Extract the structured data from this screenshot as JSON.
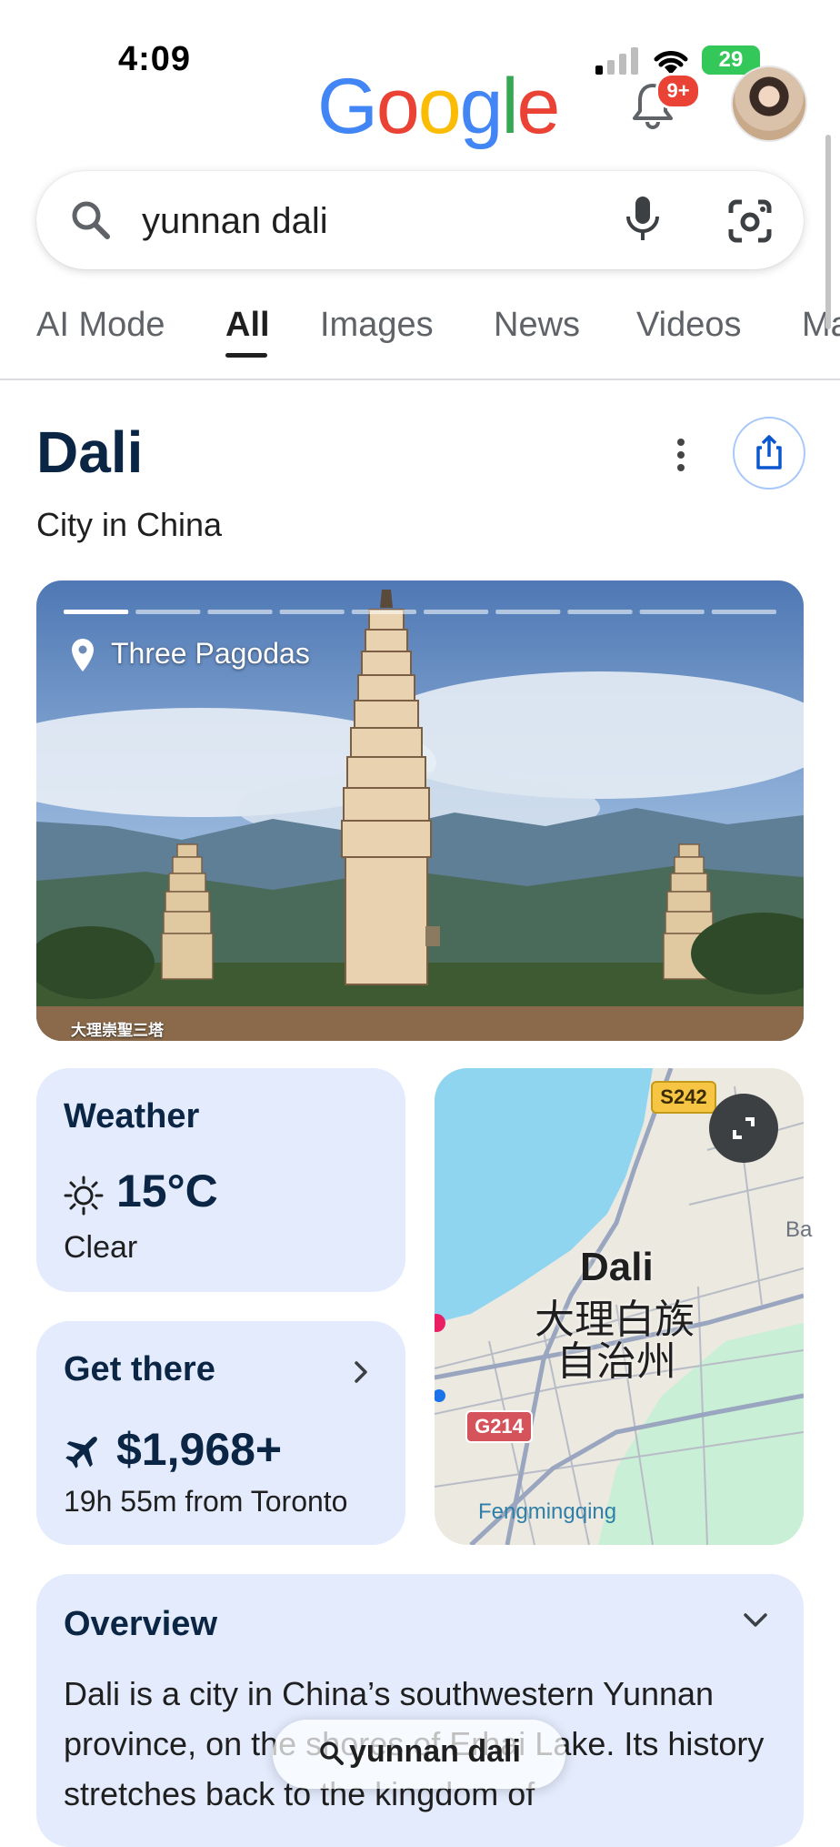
{
  "status_bar": {
    "time": "4:09",
    "battery": "29"
  },
  "header": {
    "logo_letters": [
      "G",
      "o",
      "o",
      "g",
      "l",
      "e"
    ],
    "logo_colors": [
      "#4285F4",
      "#EA4335",
      "#FBBC05",
      "#4285F4",
      "#34A853",
      "#EA4335"
    ],
    "notifications_badge": "9+"
  },
  "search": {
    "query": "yunnan dali"
  },
  "tabs": [
    {
      "label": "AI Mode",
      "active": false
    },
    {
      "label": "All",
      "active": true
    },
    {
      "label": "Images",
      "active": false
    },
    {
      "label": "News",
      "active": false
    },
    {
      "label": "Videos",
      "active": false
    },
    {
      "label": "Ma",
      "active": false
    }
  ],
  "entity": {
    "title": "Dali",
    "subtitle": "City in China"
  },
  "hero": {
    "location_label": "Three Pagodas",
    "caption": "大理崇聖三塔",
    "slides": 10,
    "active_slide": 1
  },
  "weather": {
    "title": "Weather",
    "temperature": "15°C",
    "condition": "Clear",
    "icon": "sun-icon"
  },
  "get_there": {
    "title": "Get there",
    "price": "$1,968+",
    "duration": "19h 55m from Toronto",
    "icon": "plane-icon"
  },
  "map": {
    "city_label": "Dali",
    "chinese_line1": "大理白族",
    "chinese_line2": "自治州",
    "road_s242": "S242",
    "road_g214": "G214",
    "place_fengmingqing": "Fengmingqing",
    "edge_label": "Ba"
  },
  "overview": {
    "title": "Overview",
    "text": "Dali is a city in China’s southwestern Yunnan province, on the shores of Erhai Lake. Its history stretches back to the kingdom of"
  },
  "floating_search": {
    "label": "yunnan dali"
  },
  "colors": {
    "accent_blue": "#0b57d0",
    "card_bg": "#e3ebfd",
    "title_navy": "#0b2545"
  }
}
